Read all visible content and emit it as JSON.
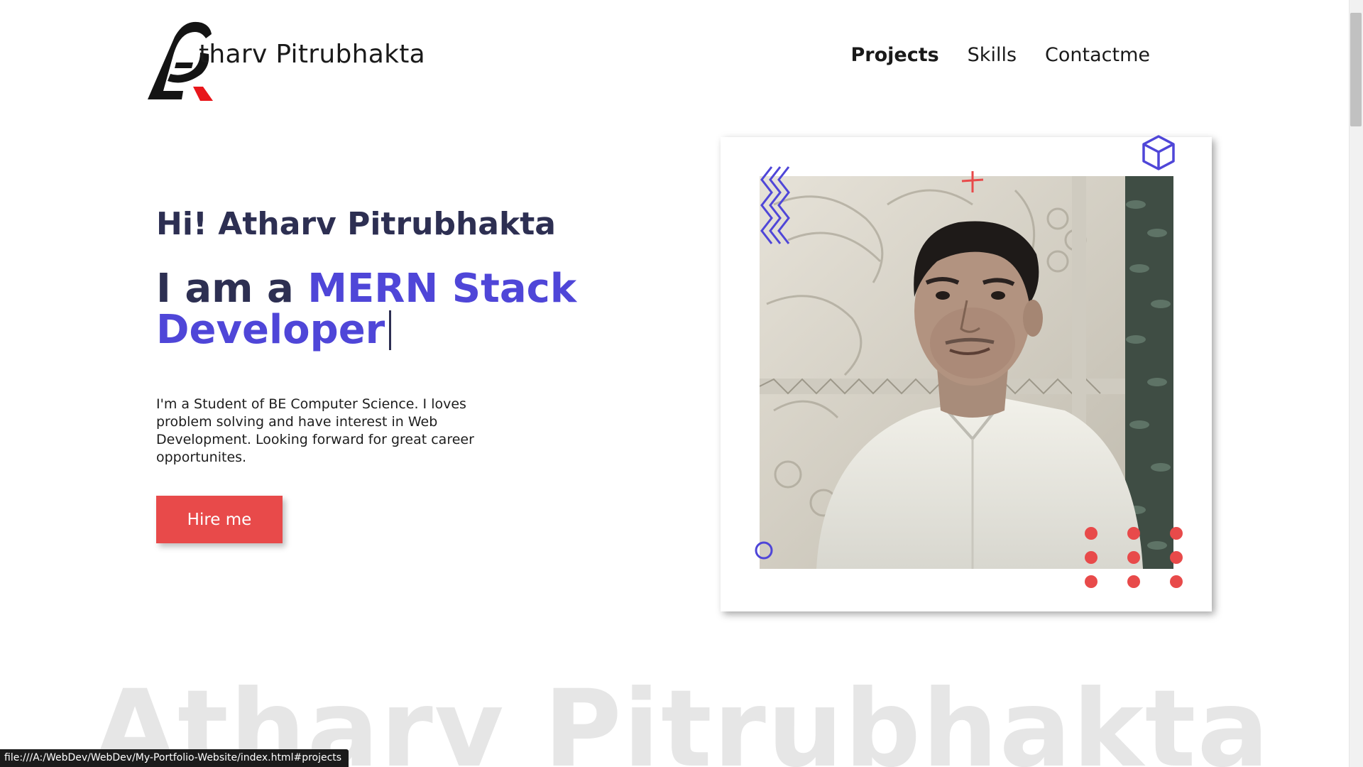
{
  "header": {
    "brand": "tharv Pitrubhakta",
    "logo_icon": "monogram-ap-logo",
    "nav": [
      {
        "label": "Projects",
        "active": true
      },
      {
        "label": "Skills",
        "active": false
      },
      {
        "label": "Contactme",
        "active": false
      }
    ]
  },
  "hero": {
    "greeting": "Hi! Atharv Pitrubhakta",
    "role_prefix": "I am a",
    "role_highlight": "MERN Stack Developer",
    "bio": "I'm a Student of BE Computer Science. I loves problem solving and have interest in Web Development. Looking forward for great career opportunites.",
    "cta": "Hire me"
  },
  "watermark": "Atharv Pitrubhakta",
  "status_url": "file:///A:/WebDev/WebDev/My-Portfolio-Website/index.html#projects",
  "colors": {
    "accent": "#4f46d8",
    "cta": "#e84a4a",
    "heading": "#2d2f52",
    "watermark": "#e6e6e6"
  }
}
